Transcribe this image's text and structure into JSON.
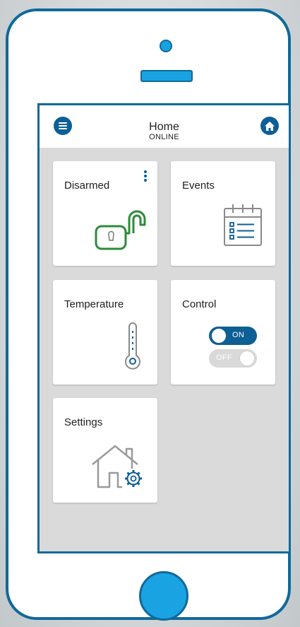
{
  "header": {
    "title": "Home",
    "status": "ONLINE",
    "menu_icon": "hamburger-menu-icon",
    "home_icon": "house-icon"
  },
  "cards": {
    "disarmed": {
      "label": "Disarmed",
      "icon": "unlocked-padlock-icon"
    },
    "events": {
      "label": "Events",
      "icon": "calendar-checklist-icon"
    },
    "temperature": {
      "label": "Temperature",
      "icon": "thermometer-icon"
    },
    "control": {
      "label": "Control",
      "toggle_on_label": "ON",
      "toggle_off_label": "OFF"
    },
    "settings": {
      "label": "Settings",
      "icon": "house-gear-icon"
    }
  },
  "colors": {
    "phone_outline": "#10699a",
    "accent_blue": "#1aa3e2",
    "app_blue": "#0d5f95",
    "lock_green": "#2e8b3a",
    "screen_bg": "#dadada"
  }
}
